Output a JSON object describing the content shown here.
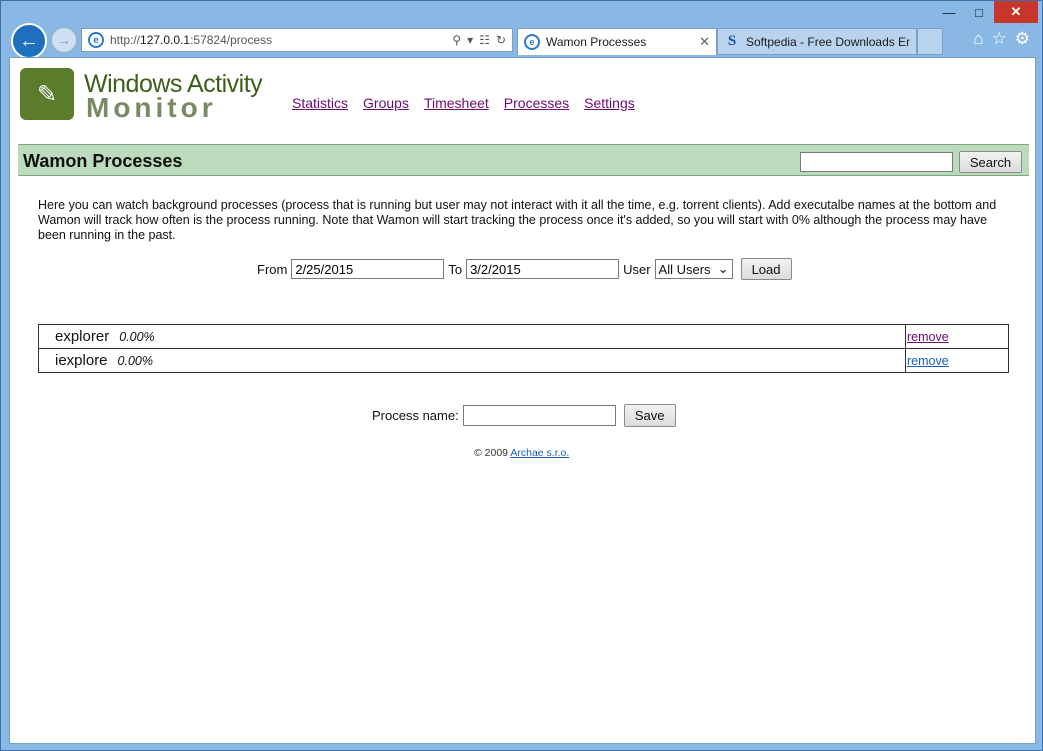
{
  "browser": {
    "address_url_prefix": "http://",
    "address_url_host": "127.0.0.1",
    "address_url_rest": ":57824/process",
    "tabs": [
      {
        "label": "Wamon Processes",
        "active": true
      },
      {
        "label": "Softpedia - Free Downloads En...",
        "active": false
      }
    ],
    "ie_icon": "ie-icon",
    "softpedia_icon_glyph": "S"
  },
  "header": {
    "brand_line1": "Windows Activity",
    "brand_line2": "Monitor",
    "nav": [
      "Statistics",
      "Groups",
      "Timesheet",
      "Processes",
      "Settings"
    ]
  },
  "band": {
    "title": "Wamon Processes",
    "search_value": "",
    "search_button": "Search"
  },
  "description": "Here you can watch background processes (process that is running but user may not interact with it all the time, e.g. torrent clients). Add executalbe names at the bottom and Wamon will track how often is the process running. Note that Wamon will start tracking the process once it's added, so you will start with 0% although the process may have been running in the past.",
  "filter": {
    "from_label": "From",
    "from_value": "2/25/2015",
    "to_label": "To",
    "to_value": "3/2/2015",
    "user_label": "User",
    "user_selected": "All Users",
    "load_button": "Load"
  },
  "processes": [
    {
      "name": "explorer",
      "percent": "0.00%",
      "action": "remove"
    },
    {
      "name": "iexplore",
      "percent": "0.00%",
      "action": "remove"
    }
  ],
  "add_process": {
    "label": "Process name:",
    "value": "",
    "save_button": "Save"
  },
  "footer": {
    "copyright": "© 2009",
    "company": "Archae s.r.o."
  },
  "colors": {
    "band_bg": "#bcdbbc",
    "link_visited": "#6b0b72",
    "link": "#1a5fb4",
    "brand_green": "#3e5e19"
  }
}
